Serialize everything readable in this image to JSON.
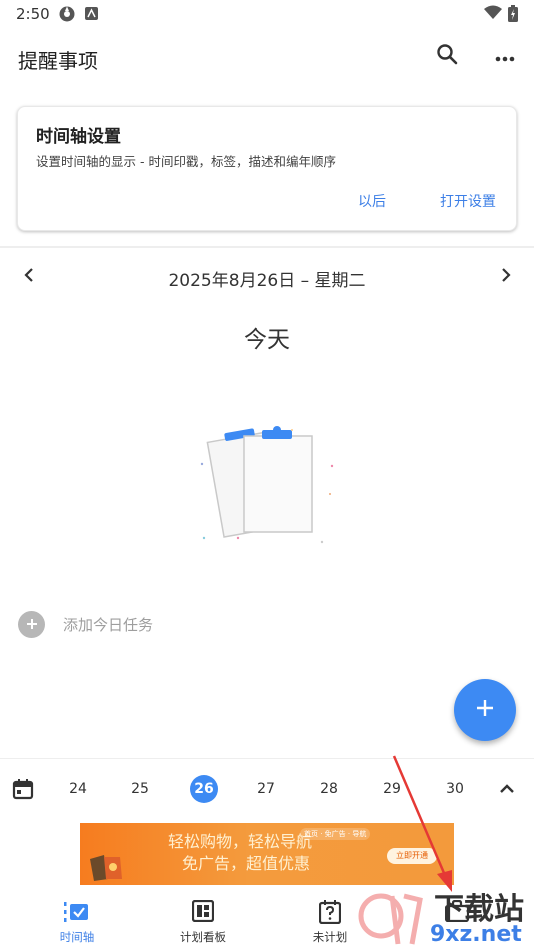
{
  "status_bar": {
    "time": "2:50"
  },
  "app_bar": {
    "title": "提醒事项",
    "icons": [
      "search-icon",
      "more-icon"
    ]
  },
  "settings_card": {
    "title": "时间轴设置",
    "description": "设置时间轴的显示 - 时间印戳，标签，描述和编年顺序",
    "later_label": "以后",
    "open_label": "打开设置"
  },
  "date_nav": {
    "date": "2025年8月26日 – 星期二",
    "today_label": "今天"
  },
  "add_task": {
    "label": "添加今日任务"
  },
  "week": {
    "days": [
      "24",
      "25",
      "26",
      "27",
      "28",
      "29",
      "30"
    ],
    "selected": "26"
  },
  "ad": {
    "line1": "轻松购物，轻松导航",
    "line2": "免广告，超值优惠",
    "tags": "首页 · 免广告 · 导航",
    "button": "立即开通"
  },
  "bottom_nav": {
    "tabs": [
      {
        "label": "时间轴",
        "icon": "timeline-icon",
        "active": true
      },
      {
        "label": "计划看板",
        "icon": "board-icon",
        "active": false
      },
      {
        "label": "未计划",
        "icon": "unplanned-icon",
        "active": false
      },
      {
        "label": "",
        "icon": "briefcase-icon",
        "active": false
      }
    ]
  },
  "watermark": {
    "brand": "下载站",
    "domain": "9xz.net"
  },
  "colors": {
    "accent": "#3d8af3",
    "link": "#3d7fe6",
    "annotation_arrow": "#e53935"
  }
}
